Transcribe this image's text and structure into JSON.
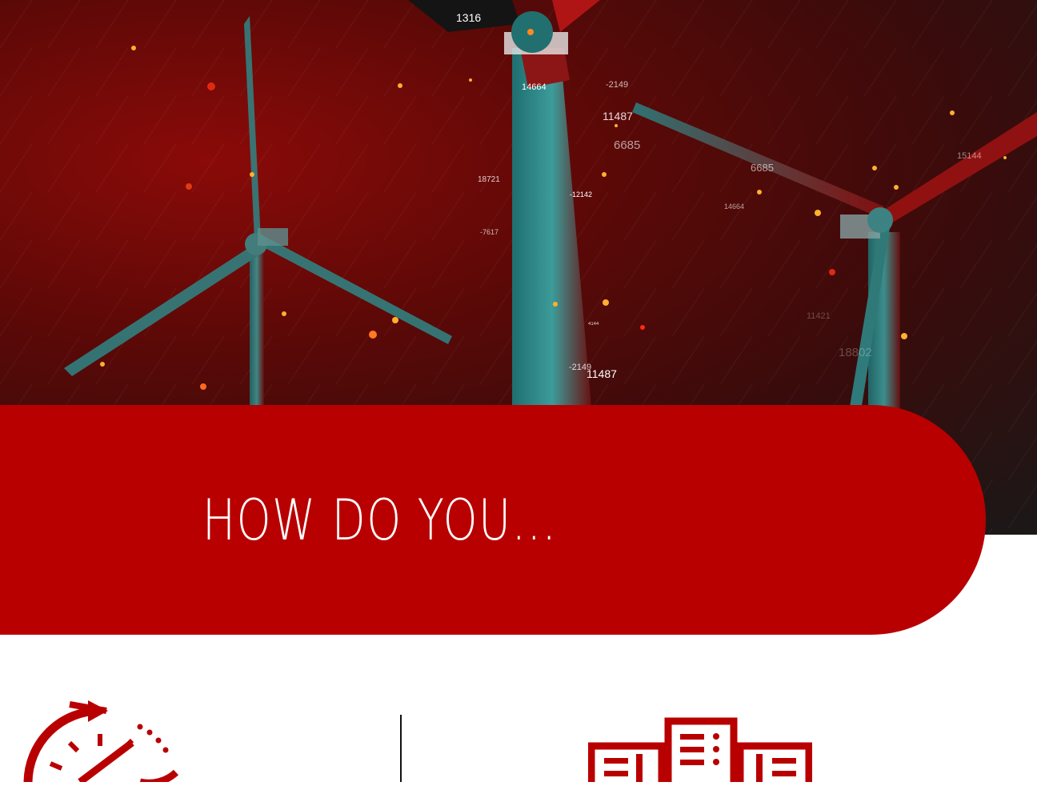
{
  "hero": {
    "overlay_numbers": [
      {
        "text": "1316"
      },
      {
        "text": "14664"
      },
      {
        "text": "-2149"
      },
      {
        "text": "11487"
      },
      {
        "text": "6685"
      },
      {
        "text": "18721"
      },
      {
        "text": "-12142"
      },
      {
        "text": "-7617"
      },
      {
        "text": "6685"
      },
      {
        "text": "14664"
      },
      {
        "text": "4144"
      },
      {
        "text": "-2149"
      },
      {
        "text": "11487"
      },
      {
        "text": "11421"
      },
      {
        "text": "18802"
      },
      {
        "text": "15144"
      }
    ]
  },
  "banner": {
    "title": "HOW DO YOU..."
  },
  "features": {
    "icons": [
      "stopwatch-arrow-icon",
      "buildings-icon"
    ]
  },
  "colors": {
    "brand_red": "#b90000",
    "turbine_teal": "#2f8a8a"
  }
}
